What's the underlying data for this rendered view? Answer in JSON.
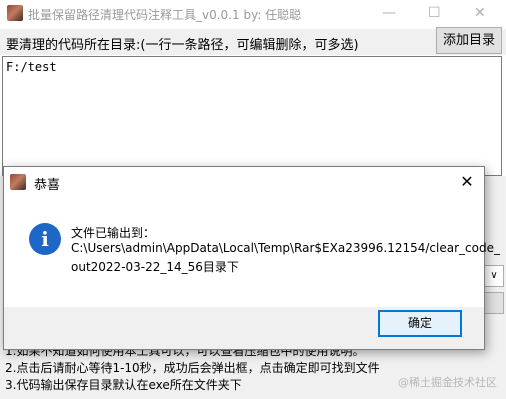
{
  "main_window": {
    "title": "批量保留路径清理代码注释工具_v0.0.1    by: 任聪聪",
    "minimize_glyph": "—",
    "maximize_glyph": "☐",
    "close_glyph": "✕",
    "dir_label": "要清理的代码所在目录:(一行一条路径，可编辑删除，可多选)",
    "add_dir_button": "添加目录",
    "path_text": "F:/test",
    "combo_arrow": "∨",
    "help_lines": [
      "1.如果不知道如何使用本工具可以，可以查看压缩包中的使用说明。",
      "2.点击后请耐心等待1-10秒，成功后会弹出框，点击确定即可找到文件",
      "3.代码输出保存目录默认在exe所在文件夹下"
    ],
    "watermark": "@稀土掘金技术社区"
  },
  "dialog": {
    "title": "恭喜",
    "close_glyph": "✕",
    "info_glyph": "i",
    "message_lines": [
      "文件已输出到：",
      "C:\\Users\\admin\\AppData\\Local\\Temp\\Rar$EXa23996.12154/clear_code_",
      "out2022-03-22_14_56目录下"
    ],
    "ok_button": "确定"
  },
  "colors": {
    "accent": "#0078d7",
    "info_icon": "#1f67c6",
    "window_bg": "#f0f0f0"
  }
}
